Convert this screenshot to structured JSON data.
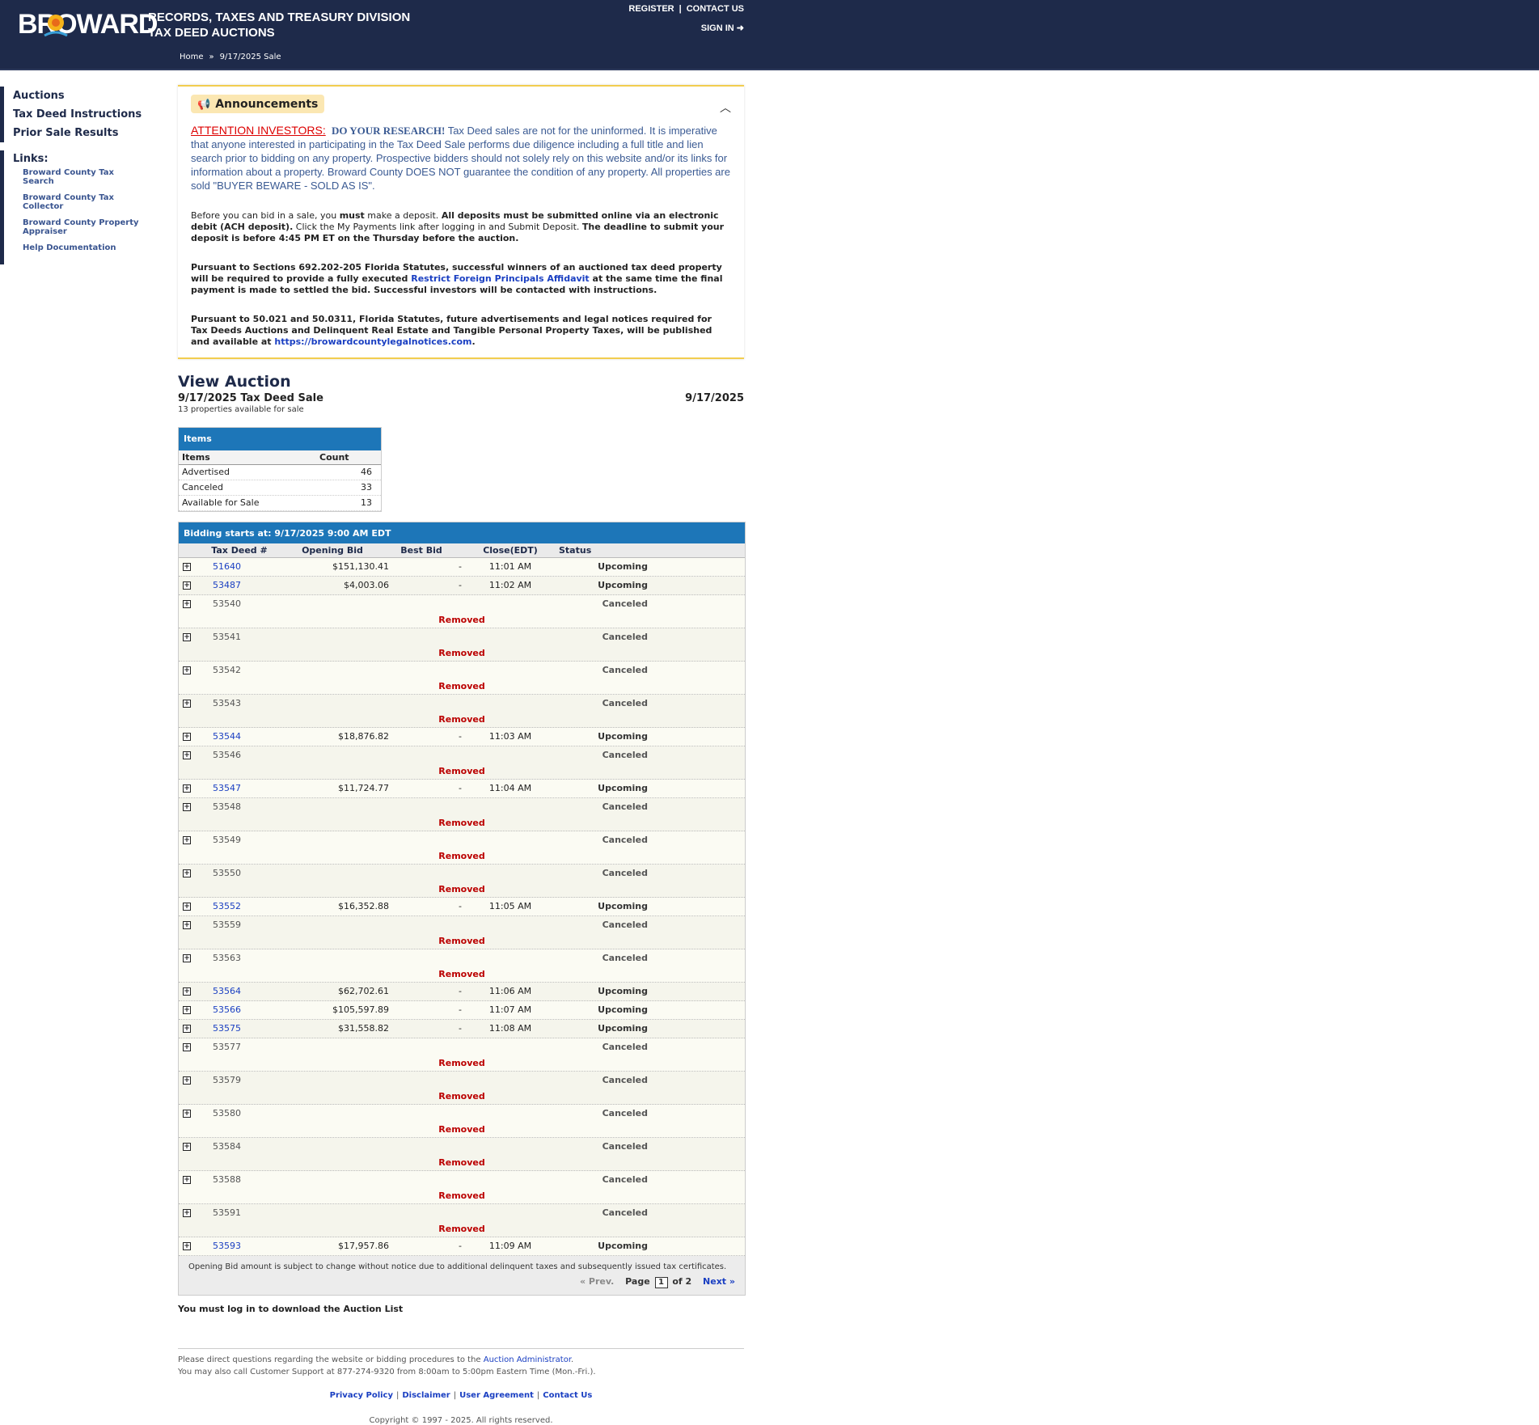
{
  "header": {
    "logo_text": "BROWARD",
    "title_line1": "RECORDS, TAXES AND TREASURY DIVISION",
    "title_line2": "TAX DEED AUCTIONS",
    "register": "REGISTER",
    "contact": "CONTACT US",
    "signin": "SIGN IN",
    "breadcrumb_home": "Home",
    "breadcrumb_sep": "»",
    "breadcrumb_current": "9/17/2025 Sale"
  },
  "nav": {
    "items": [
      "Auctions",
      "Tax Deed Instructions",
      "Prior Sale Results"
    ],
    "links_title": "Links:",
    "links": [
      "Broward County Tax Search",
      "Broward County Tax Collector",
      "Broward County Property Appraiser",
      "Help Documentation"
    ]
  },
  "announcements": {
    "title": "Announcements",
    "attention": "ATTENTION INVESTORS:",
    "do_research": "DO YOUR RESEARCH!",
    "attention_body": " Tax Deed sales are not for the uninformed. It is imperative that anyone interested in participating in the Tax Deed Sale performs due diligence including a full title and lien search prior to bidding on any property. Prospective bidders should not solely rely on this website and/or its links for information about a property. Broward County DOES NOT guarantee the condition of any property.  All properties are sold \"BUYER BEWARE - SOLD AS IS\".",
    "deposit_a": "Before you can bid in a sale, you ",
    "deposit_must": "must",
    "deposit_b": " make a deposit. ",
    "deposit_bold1": "All deposits must be submitted online via an electronic debit (ACH deposit).",
    "deposit_c": " Click the My Payments link after logging in and Submit Deposit. ",
    "deposit_bold2": "The deadline to submit your deposit is before 4:45 PM ET on the Thursday before the auction.",
    "statute_a": "Pursuant to Sections 692.202-205 Florida Statutes, successful winners of an auctioned tax deed property will be required to provide a fully executed ",
    "statute_link": "Restrict Foreign Principals Affidavit",
    "statute_b": " at the same time the final payment is made to settled the bid. Successful investors will be contacted with instructions.",
    "legal_a": "Pursuant to 50.021 and 50.0311, Florida Statutes, future advertisements and legal notices required for Tax Deeds Auctions and Delinquent Real Estate and Tangible Personal Property Taxes, will be published and available at ",
    "legal_link": "https://browardcountylegalnotices.com",
    "legal_b": "."
  },
  "view": {
    "title": "View Auction",
    "sale_name": "9/17/2025 Tax Deed Sale",
    "sale_date": "9/17/2025",
    "available": "13 properties available for sale"
  },
  "items_table": {
    "title": "Items",
    "col_items": "Items",
    "col_count": "Count",
    "rows": [
      {
        "label": "Advertised",
        "count": "46"
      },
      {
        "label": "Canceled",
        "count": "33"
      },
      {
        "label": "Available for Sale",
        "count": "13"
      }
    ]
  },
  "auction": {
    "header": "Bidding starts at: 9/17/2025 9:00 AM EDT",
    "columns": [
      "Tax Deed #",
      "Opening Bid",
      "Best Bid",
      "Close(EDT)",
      "Status"
    ],
    "removed_label": "Removed",
    "rows": [
      {
        "id": "51640",
        "opening": "$151,130.41",
        "best": "-",
        "close": "11:01 AM",
        "status": "Upcoming"
      },
      {
        "id": "53487",
        "opening": "$4,003.06",
        "best": "-",
        "close": "11:02 AM",
        "status": "Upcoming"
      },
      {
        "id": "53540",
        "opening": "",
        "best": "",
        "close": "",
        "status": "Canceled"
      },
      {
        "id": "53541",
        "opening": "",
        "best": "",
        "close": "",
        "status": "Canceled"
      },
      {
        "id": "53542",
        "opening": "",
        "best": "",
        "close": "",
        "status": "Canceled"
      },
      {
        "id": "53543",
        "opening": "",
        "best": "",
        "close": "",
        "status": "Canceled"
      },
      {
        "id": "53544",
        "opening": "$18,876.82",
        "best": "-",
        "close": "11:03 AM",
        "status": "Upcoming"
      },
      {
        "id": "53546",
        "opening": "",
        "best": "",
        "close": "",
        "status": "Canceled"
      },
      {
        "id": "53547",
        "opening": "$11,724.77",
        "best": "-",
        "close": "11:04 AM",
        "status": "Upcoming"
      },
      {
        "id": "53548",
        "opening": "",
        "best": "",
        "close": "",
        "status": "Canceled"
      },
      {
        "id": "53549",
        "opening": "",
        "best": "",
        "close": "",
        "status": "Canceled"
      },
      {
        "id": "53550",
        "opening": "",
        "best": "",
        "close": "",
        "status": "Canceled"
      },
      {
        "id": "53552",
        "opening": "$16,352.88",
        "best": "-",
        "close": "11:05 AM",
        "status": "Upcoming"
      },
      {
        "id": "53559",
        "opening": "",
        "best": "",
        "close": "",
        "status": "Canceled"
      },
      {
        "id": "53563",
        "opening": "",
        "best": "",
        "close": "",
        "status": "Canceled"
      },
      {
        "id": "53564",
        "opening": "$62,702.61",
        "best": "-",
        "close": "11:06 AM",
        "status": "Upcoming"
      },
      {
        "id": "53566",
        "opening": "$105,597.89",
        "best": "-",
        "close": "11:07 AM",
        "status": "Upcoming"
      },
      {
        "id": "53575",
        "opening": "$31,558.82",
        "best": "-",
        "close": "11:08 AM",
        "status": "Upcoming"
      },
      {
        "id": "53577",
        "opening": "",
        "best": "",
        "close": "",
        "status": "Canceled"
      },
      {
        "id": "53579",
        "opening": "",
        "best": "",
        "close": "",
        "status": "Canceled"
      },
      {
        "id": "53580",
        "opening": "",
        "best": "",
        "close": "",
        "status": "Canceled"
      },
      {
        "id": "53584",
        "opening": "",
        "best": "",
        "close": "",
        "status": "Canceled"
      },
      {
        "id": "53588",
        "opening": "",
        "best": "",
        "close": "",
        "status": "Canceled"
      },
      {
        "id": "53591",
        "opening": "",
        "best": "",
        "close": "",
        "status": "Canceled"
      },
      {
        "id": "53593",
        "opening": "$17,957.86",
        "best": "-",
        "close": "11:09 AM",
        "status": "Upcoming"
      }
    ],
    "footnote": "Opening Bid amount is subject to change without notice due to additional delinquent taxes and subsequently issued tax certificates.",
    "prev": "« Prev.",
    "page_label": "Page",
    "page_value": "1",
    "of_label": "of 2",
    "next": "Next »"
  },
  "login_note": "You must log in to download the Auction List",
  "footer": {
    "note1_a": "Please direct questions regarding the website or bidding procedures to the ",
    "note1_link": "Auction Administrator",
    "note1_b": ".",
    "note2": "You may also call Customer Support at 877-274-9320 from 8:00am to 5:00pm Eastern Time (Mon.-Fri.).",
    "links": [
      "Privacy Policy",
      "Disclaimer",
      "User Agreement",
      "Contact Us"
    ],
    "copyright": "Copyright © 1997 - 2025. All rights reserved."
  },
  "icons": {
    "megaphone": "megaphone-icon",
    "chevron": "chevron-up-icon",
    "signin": "sign-in-icon",
    "expand": "expand-plus-icon"
  },
  "colors": {
    "header_bg": "#1e2a4a",
    "accent_blue": "#1d76b8",
    "announce_border": "#f2cd4f",
    "removed_red": "#b00000",
    "link_blue": "#1a3fc2"
  }
}
